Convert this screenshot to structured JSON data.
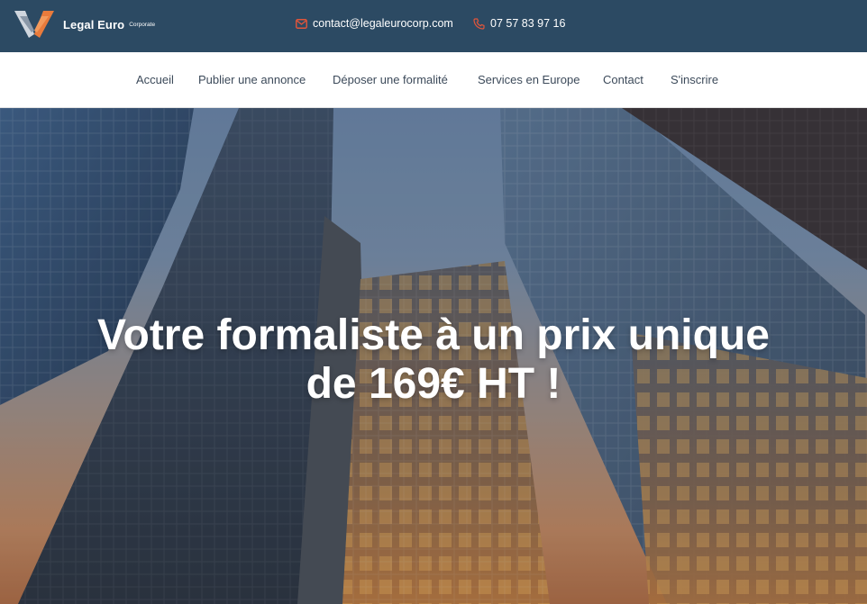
{
  "brand": {
    "name": "Legal Euro",
    "tagline": "Corporate",
    "logo_icon": "v-chevron-logo-icon",
    "colors": {
      "top_bar": "#2c4a63",
      "accent": "#e2553a",
      "logo_orange": "#e97b3c"
    }
  },
  "contact": {
    "email": "contact@legaleurocorp.com",
    "email_icon": "mail-icon",
    "phone": "07 57 83 97 16",
    "phone_icon": "phone-icon"
  },
  "nav": {
    "items": [
      {
        "label": "Accueil"
      },
      {
        "label": "Publier une annonce"
      },
      {
        "label": "Déposer une formalité"
      },
      {
        "label": "Services en Europe"
      },
      {
        "label": "Contact"
      },
      {
        "label": "S'inscrire"
      }
    ]
  },
  "hero": {
    "title_line1": "Votre formaliste à un prix unique",
    "title_line2": "de 169€ HT !"
  }
}
